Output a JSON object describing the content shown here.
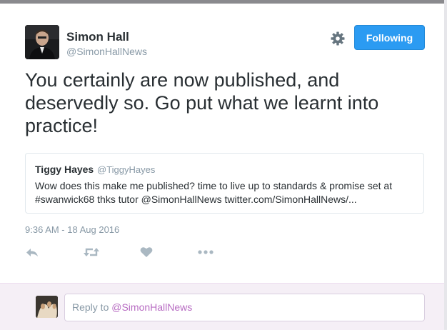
{
  "author": {
    "name": "Simon Hall",
    "handle": "@SimonHallNews"
  },
  "header": {
    "gear_icon": "gear-icon",
    "follow_label": "Following",
    "follow_color": "#2b9bf2"
  },
  "tweet": {
    "text": "You certainly are now published, and deservedly so. Go put what we learnt into practice!",
    "timestamp": "9:36 AM - 18 Aug 2016"
  },
  "quoted": {
    "name": "Tiggy Hayes",
    "handle": "@TiggyHayes",
    "text": "Wow does this make me published? time to live up to standards & promise set at #swanwick68 thks tutor @SimonHallNews twitter.com/SimonHallNews/..."
  },
  "actions": {
    "icons": [
      "reply-icon",
      "retweet-icon",
      "like-icon",
      "more-icon"
    ],
    "icon_color": "#aab8c2"
  },
  "reply": {
    "prefix": "Reply to ",
    "mention": "@SimonHallNews",
    "mention_color": "#b76bc2"
  }
}
